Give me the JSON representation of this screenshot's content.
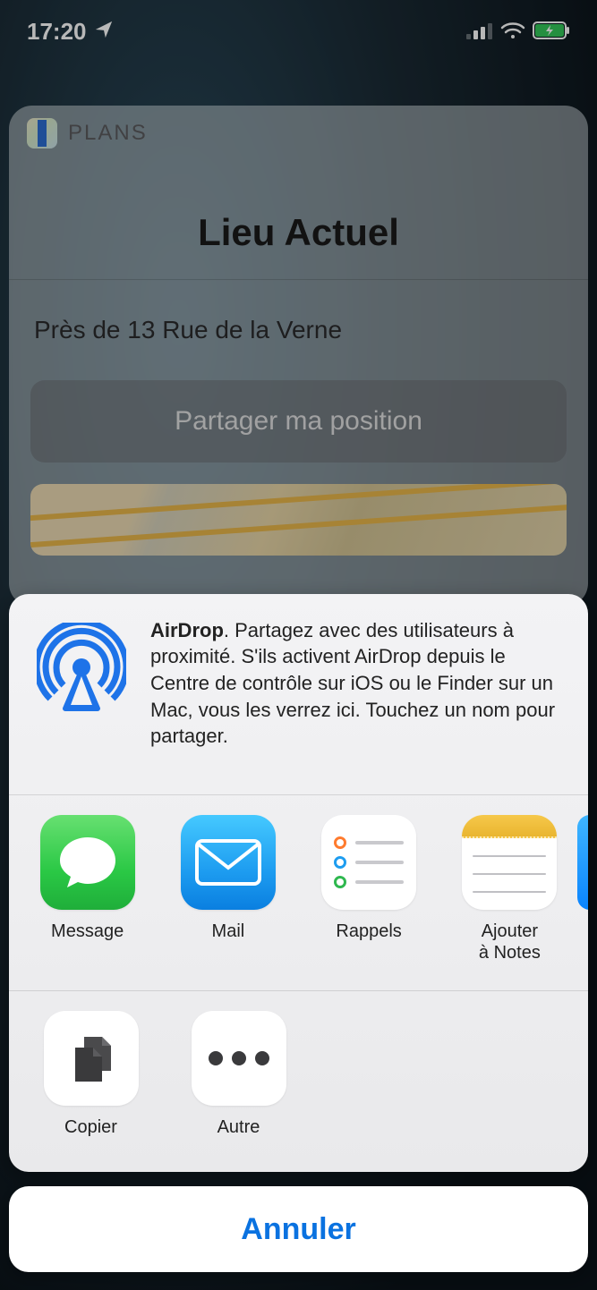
{
  "status": {
    "time": "17:20",
    "location_arrow": "location-arrow-icon",
    "signal": "signal-icon",
    "wifi": "wifi-icon",
    "battery": "battery-charging-icon"
  },
  "background_card": {
    "app_name": "PLANS",
    "title": "Lieu Actuel",
    "address": "Près de 13 Rue de la Verne",
    "share_button": "Partager ma position"
  },
  "share_sheet": {
    "airdrop": {
      "title": "AirDrop",
      "description": ". Partagez avec des utilisateurs à proximité. S'ils activent AirDrop depuis le Centre de contrôle sur iOS ou le Finder sur un Mac, vous les verrez ici. Touchez un nom pour partager."
    },
    "apps": [
      {
        "id": "message",
        "label": "Message"
      },
      {
        "id": "mail",
        "label": "Mail"
      },
      {
        "id": "reminders",
        "label": "Rappels"
      },
      {
        "id": "notes",
        "label": "Ajouter\nà Notes"
      }
    ],
    "actions": [
      {
        "id": "copy",
        "label": "Copier"
      },
      {
        "id": "other",
        "label": "Autre"
      }
    ],
    "cancel": "Annuler"
  }
}
